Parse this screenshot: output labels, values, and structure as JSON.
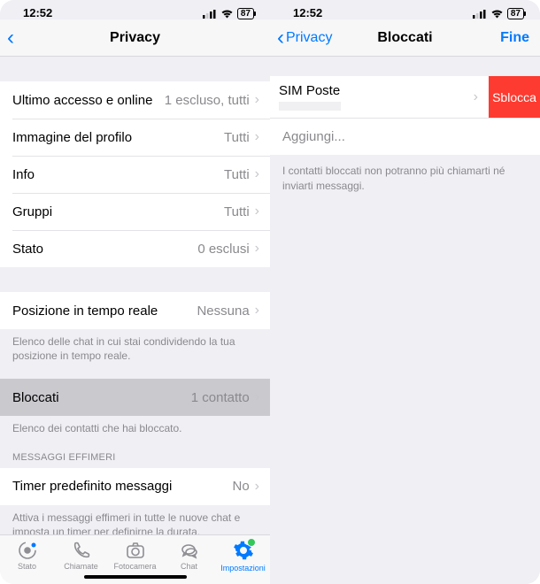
{
  "status": {
    "time": "12:52",
    "battery_pct": "87"
  },
  "left": {
    "nav_title": "Privacy",
    "rows": {
      "last_seen": {
        "label": "Ultimo accesso e online",
        "value": "1 escluso, tutti"
      },
      "profile_img": {
        "label": "Immagine del profilo",
        "value": "Tutti"
      },
      "info": {
        "label": "Info",
        "value": "Tutti"
      },
      "groups": {
        "label": "Gruppi",
        "value": "Tutti"
      },
      "status": {
        "label": "Stato",
        "value": "0 esclusi"
      },
      "live_loc": {
        "label": "Posizione in tempo reale",
        "value": "Nessuna"
      },
      "blocked": {
        "label": "Bloccati",
        "value": "1 contatto"
      },
      "timer": {
        "label": "Timer predefinito messaggi",
        "value": "No"
      }
    },
    "notes": {
      "live_loc": "Elenco delle chat in cui stai condividendo la tua posizione in tempo reale.",
      "blocked": "Elenco dei contatti che hai bloccato.",
      "ephemeral_header": "MESSAGGI EFFIMERI",
      "timer": "Attiva i messaggi effimeri in tutte le nuove chat e imposta un timer per definirne la durata."
    },
    "tabs": {
      "status": "Stato",
      "calls": "Chiamate",
      "camera": "Fotocamera",
      "chat": "Chat",
      "settings": "Impostazioni"
    }
  },
  "right": {
    "nav_back": "Privacy",
    "nav_title": "Bloccati",
    "nav_done": "Fine",
    "contact_name": "SIM Poste",
    "unblock_label": "Sblocca",
    "add_label": "Aggiungi...",
    "note": "I contatti bloccati non potranno più chiamarti né inviarti messaggi."
  }
}
